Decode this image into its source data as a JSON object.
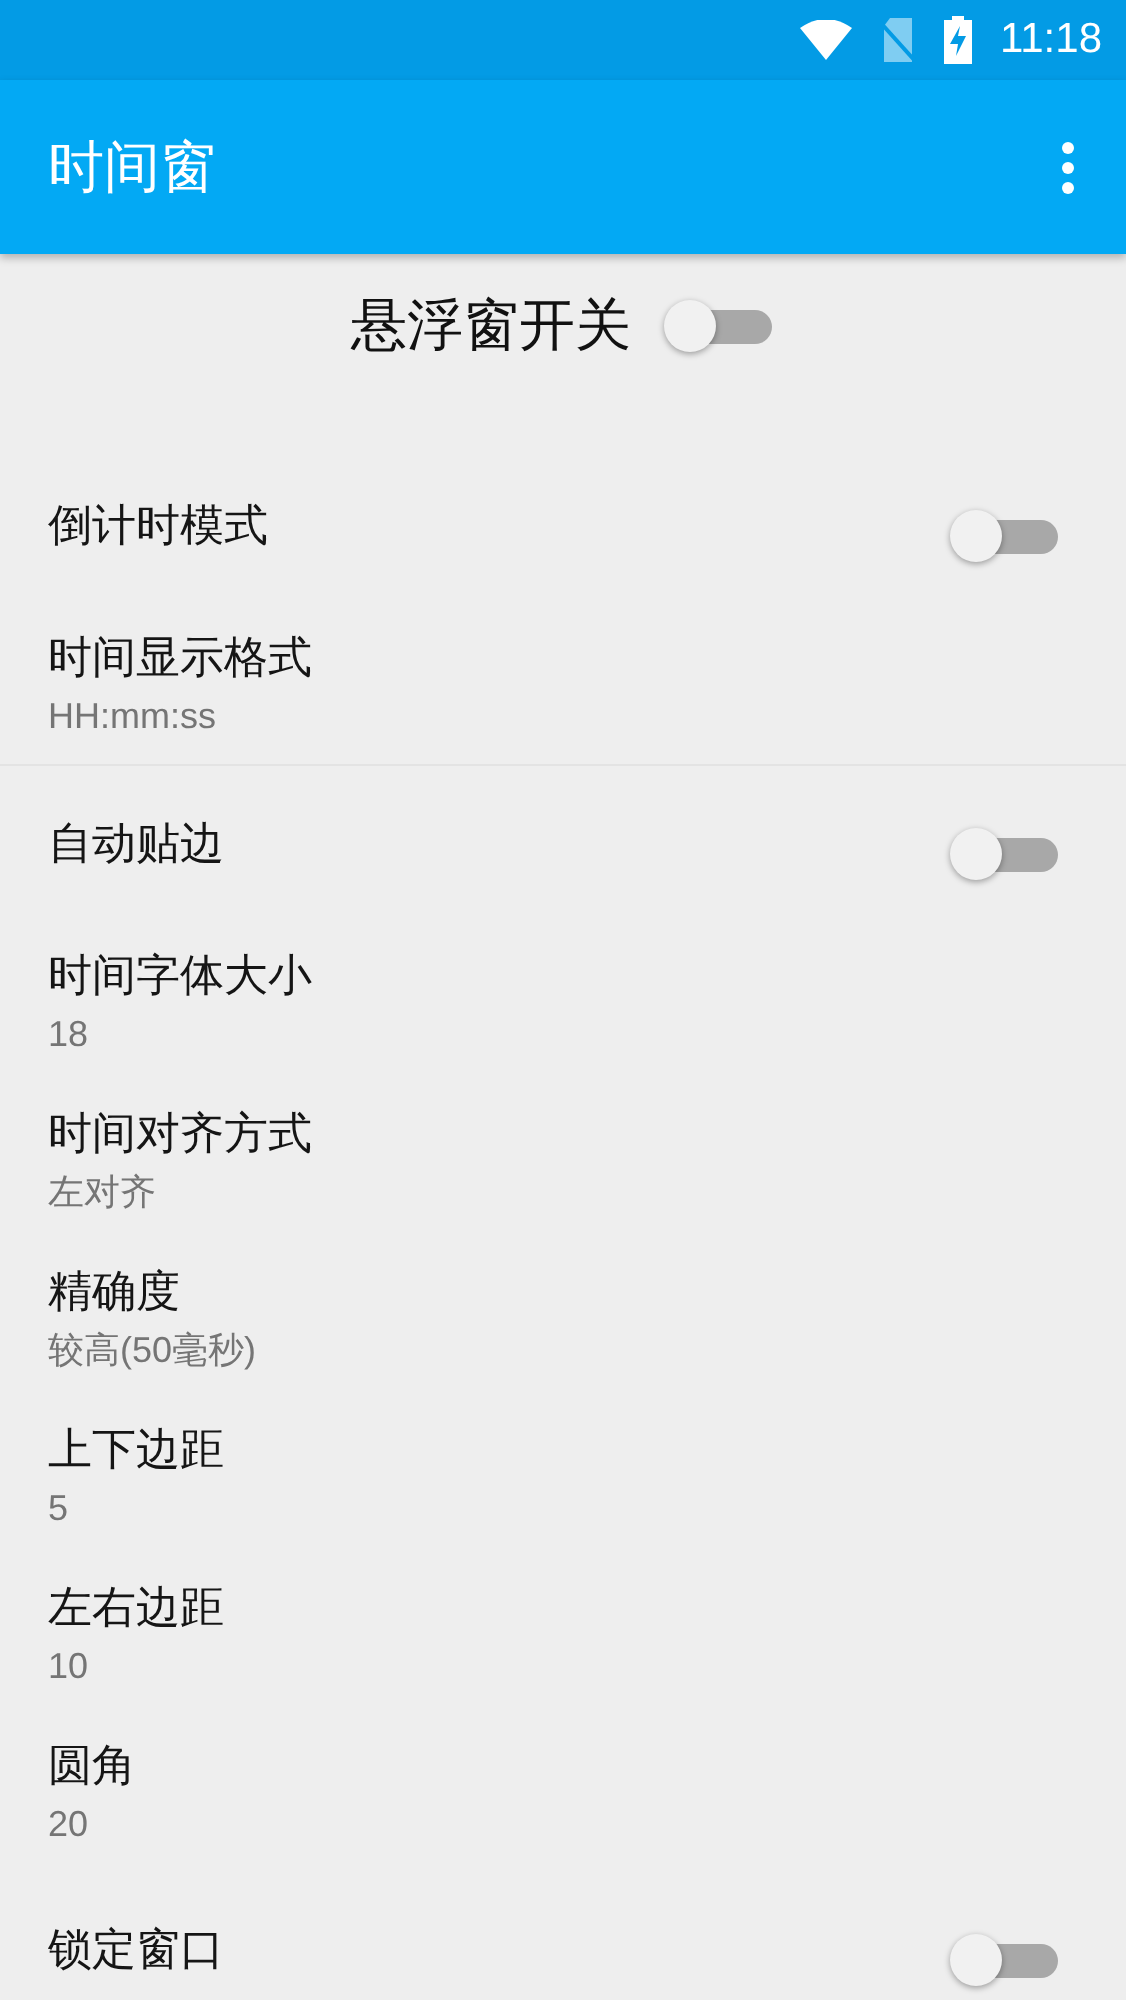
{
  "status_bar": {
    "time": "11:18"
  },
  "app_bar": {
    "title": "时间窗"
  },
  "master_switch": {
    "label": "悬浮窗开关",
    "on": false
  },
  "sections": [
    {
      "items": [
        {
          "kind": "switch",
          "title": "倒计时模式",
          "on": false
        },
        {
          "kind": "value",
          "title": "时间显示格式",
          "summary": "HH:mm:ss"
        }
      ]
    },
    {
      "items": [
        {
          "kind": "switch",
          "title": "自动贴边",
          "on": false
        },
        {
          "kind": "value",
          "title": "时间字体大小",
          "summary": "18"
        },
        {
          "kind": "value",
          "title": "时间对齐方式",
          "summary": "左对齐"
        },
        {
          "kind": "value",
          "title": "精确度",
          "summary": "较高(50毫秒)"
        },
        {
          "kind": "value",
          "title": "上下边距",
          "summary": "5"
        },
        {
          "kind": "value",
          "title": "左右边距",
          "summary": "10"
        },
        {
          "kind": "value",
          "title": "圆角",
          "summary": "20"
        },
        {
          "kind": "switch",
          "title": "锁定窗口",
          "on": false
        }
      ]
    }
  ]
}
